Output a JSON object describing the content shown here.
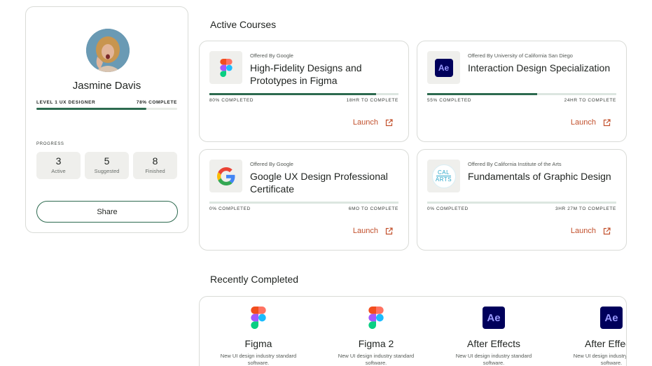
{
  "profile": {
    "name": "Jasmine Davis",
    "level": "LEVEL 1 UX DESIGNER",
    "level_complete": "78% COMPLETE",
    "level_progress": 0.78,
    "progress_label": "PROGRESS",
    "stats": [
      {
        "value": "3",
        "label": "Active"
      },
      {
        "value": "5",
        "label": "Suggested"
      },
      {
        "value": "8",
        "label": "Finished"
      }
    ],
    "share_label": "Share"
  },
  "active_title": "Active Courses",
  "courses": [
    {
      "offered": "Offered By Google",
      "title": "High-Fidelity Designs and Prototypes in Figma",
      "completed": "80% COMPLETED",
      "progress": 0.88,
      "remaining": "18HR TO COMPLETE",
      "launch": "Launch",
      "icon": "figma-logo-icon"
    },
    {
      "offered": "Offered By University of California San Diego",
      "title": "Interaction Design Specialization",
      "completed": "55% COMPLETED",
      "progress": 0.58,
      "remaining": "24HR TO COMPLETE",
      "launch": "Launch",
      "icon": "after-effects-logo-icon"
    },
    {
      "offered": "Offered By Google",
      "title": "Google UX Design Professional Certificate",
      "completed": "0% COMPLETED",
      "progress": 0.0,
      "remaining": "6MO TO COMPLETE",
      "launch": "Launch",
      "icon": "google-logo-icon"
    },
    {
      "offered": "Offered By California Institute of the Arts",
      "title": "Fundamentals of Graphic Design",
      "completed": "0% COMPLETED",
      "progress": 0.0,
      "remaining": "3HR 27M TO COMPLETE",
      "launch": "Launch",
      "icon": "calarts-logo-icon"
    }
  ],
  "recent_title": "Recently Completed",
  "recent": [
    {
      "name": "Figma",
      "desc": "New UI design industry standard software.",
      "icon": "figma-logo-icon"
    },
    {
      "name": "Figma 2",
      "desc": "New UI design industry standard software.",
      "icon": "figma-logo-icon"
    },
    {
      "name": "After Effects",
      "desc": "New UI design industry standard software.",
      "icon": "after-effects-logo-icon"
    },
    {
      "name": "After Effects",
      "desc": "New UI design industry standard software.",
      "icon": "after-effects-logo-icon"
    }
  ],
  "logos": {
    "ae_text": "Ae",
    "calarts_top": "CAL",
    "calarts_bottom": "ARTS"
  },
  "colors": {
    "accent_green": "#2d6a4f",
    "launch_orange": "#c2502c",
    "ae_bg": "#00005b"
  }
}
